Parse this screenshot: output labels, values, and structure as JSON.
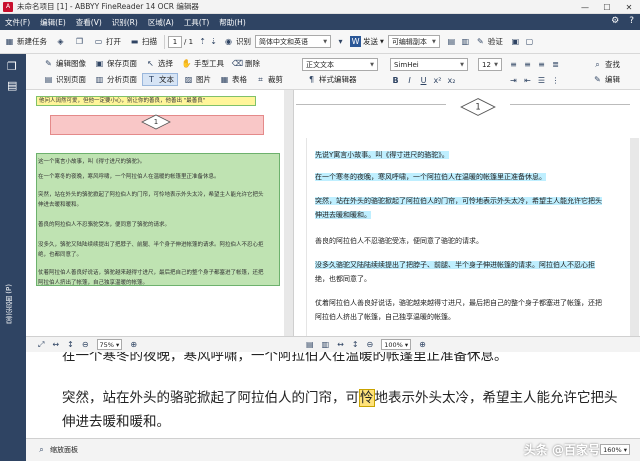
{
  "window": {
    "title": "未命名项目 [1] - ABBYY FineReader 14 OCR 编辑器",
    "min": "—",
    "max": "☐",
    "close": "✕"
  },
  "menu": [
    "文件(F)",
    "编辑(E)",
    "查看(V)",
    "识别(R)",
    "区域(A)",
    "工具(T)",
    "帮助(H)"
  ],
  "toolbar": {
    "new_task": "新建任务",
    "open": "打开",
    "scan": "扫描",
    "page_current": "1",
    "page_total": "/ 1",
    "recognize": "识别",
    "language": "简体中文和英语",
    "send": "发送",
    "doc_type": "可编辑副本",
    "verify": "验证"
  },
  "image_tools": {
    "edit_image": "编辑图像",
    "save_page": "保存页面",
    "select": "选择",
    "hand_tool": "手型工具",
    "delete": "删除",
    "recognize_page": "识别页面",
    "analyze_page": "分析页面",
    "text": "文本",
    "picture": "图片",
    "table": "表格",
    "crop": "裁剪"
  },
  "text_tools": {
    "style_select": "正文文本",
    "font_select": "SimHei",
    "style_editor": "样式编辑器",
    "search": "查找",
    "edit": "编辑",
    "font_size": "12"
  },
  "left_sidebar": {
    "label": "显示页面 (P)"
  },
  "image_pane": {
    "top_strip": "他问人阔然可爱，但他一定要小心，别让你的善良，他善出 \"最善良\"",
    "scan_lines": [
      "这一个寓言小故事，叫《得寸进尺的骆驼》。",
      "在一个寒冬的夜晚，寒风呼啸，一个阿拉伯人在温暖的帐篷里正准备休息。",
      "突然，站在外头的骆驼掀起了阿拉伯人的门帘，可怜地表示外头太冷，希望主人能允许它把头",
      "伸进去暖和暖和。",
      "善良的阿拉伯人不忍骆驼受冻，便同意了骆驼的请求。",
      "没多久，骆驼又陆陆续续提出了把脖子、前腿、半个身子伸进帐篷的请求。阿拉伯人不忍心拒",
      "绝，也都同意了。",
      "仗着阿拉伯人善良好说话，骆驼越来越得寸进尺，最后把自己的整个身子都塞进了帐篷，还把",
      "阿拉伯人挤出了帐篷，自己独享温暖的帐篷。"
    ],
    "zoom": "75%"
  },
  "text_pane": {
    "lines": [
      "先说Y寓言小故事。叫《得寸进尺的骆驼》。",
      "在一个寒冬的夜晚，寒风呼啸，一个阿拉伯人在温暖的帐篷里正准备休息。",
      "突然，站在外头的骆驼掀起了阿拉伯人的门帘，可怜地表示外头太冷，希望主人能允许它把头",
      "伸进去暖和暖和。",
      "善良的阿拉伯人不忍骆驼受冻，便同意了骆驼的请求。",
      "没多久骆驼又陆陆续续提出了把脖子、前腿、半个身子伸进帐篷的请求。阿拉伯人不忍心拒",
      "绝，也都同意了。",
      "仗着阿拉伯人善良好说话，骆驼越来越得寸进尺，最后把自己的整个身子都塞进了帐篷，还把",
      "阿拉伯人挤出了帐篷，自己独享温暖的帐篷。"
    ],
    "zoom": "100%"
  },
  "zoom_pane": {
    "line_top": "在一个寒冬的夜晚，寒风呼啸，一个阿拉伯人在温暖的帐篷里正准备休息。",
    "line1_pre": "突然，站在外头的骆驼掀起了阿拉伯人的门帘，可",
    "line1_hl": "怜",
    "line1_post": "地表示外头太冷，希望主人能允许它把头",
    "line2": "伸进去暖和暖和。",
    "zoom": "160%"
  },
  "bottom": {
    "zoom_panel": "缩放面板",
    "watermark": "头条 @百家号"
  }
}
